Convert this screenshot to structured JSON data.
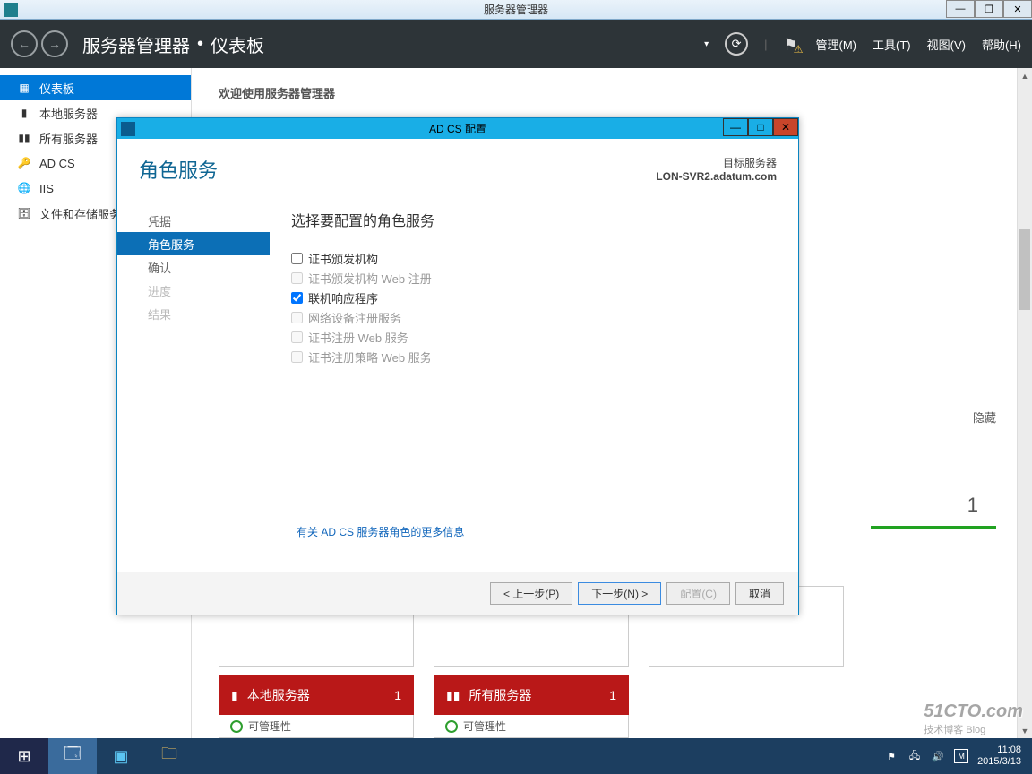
{
  "window": {
    "title": "服务器管理器"
  },
  "header": {
    "breadcrumb_app": "服务器管理器",
    "breadcrumb_page": "仪表板",
    "menu": {
      "manage": "管理(M)",
      "tools": "工具(T)",
      "view": "视图(V)",
      "help": "帮助(H)"
    }
  },
  "sidebar": {
    "items": [
      {
        "icon": "▦",
        "label": "仪表板"
      },
      {
        "icon": "▮",
        "label": "本地服务器"
      },
      {
        "icon": "▮▮",
        "label": "所有服务器"
      },
      {
        "icon": "🔑",
        "label": "AD CS"
      },
      {
        "icon": "🌐",
        "label": "IIS"
      },
      {
        "icon": "🗄",
        "label": "文件和存储服务"
      }
    ]
  },
  "content": {
    "welcome": "欢迎使用服务器管理器",
    "hide": "隐藏",
    "num_box": "1",
    "tiles": [
      {
        "title": "本地服务器",
        "count": "1",
        "sub": "可管理性"
      },
      {
        "title": "所有服务器",
        "count": "1",
        "sub": "可管理性"
      }
    ]
  },
  "dialog": {
    "title": "AD CS 配置",
    "heading": "角色服务",
    "target_label": "目标服务器",
    "target_server": "LON-SVR2.adatum.com",
    "nav": [
      "凭据",
      "角色服务",
      "确认",
      "进度",
      "结果"
    ],
    "section_title": "选择要配置的角色服务",
    "options": [
      {
        "label": "证书颁发机构",
        "enabled": true,
        "checked": false
      },
      {
        "label": "证书颁发机构 Web 注册",
        "enabled": false,
        "checked": false
      },
      {
        "label": "联机响应程序",
        "enabled": true,
        "checked": true
      },
      {
        "label": "网络设备注册服务",
        "enabled": false,
        "checked": false
      },
      {
        "label": "证书注册 Web 服务",
        "enabled": false,
        "checked": false
      },
      {
        "label": "证书注册策略 Web 服务",
        "enabled": false,
        "checked": false
      }
    ],
    "more_link": "有关 AD CS 服务器角色的更多信息",
    "buttons": {
      "prev": "< 上一步(P)",
      "next": "下一步(N) >",
      "configure": "配置(C)",
      "cancel": "取消"
    }
  },
  "taskbar": {
    "time": "11:08",
    "date": "2015/3/13"
  },
  "watermark": {
    "main": "51CTO.com",
    "sub": "技术博客 Blog"
  }
}
